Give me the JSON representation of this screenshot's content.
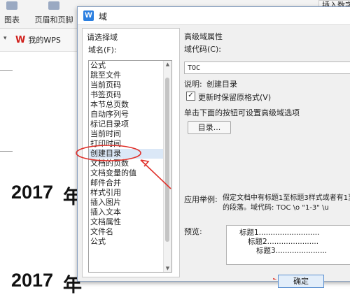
{
  "ribbon": {
    "chart_label": "图表",
    "header_footer_label": "页眉和页脚",
    "insert_number_label": "插入数字"
  },
  "tabs": {
    "wps_label": "我的WPS"
  },
  "document": {
    "line1_year": "2017",
    "line1_rest": "年",
    "line2_year": "2017",
    "line2_rest": "年"
  },
  "dialog": {
    "title": "域",
    "left": {
      "section_title": "请选择域",
      "field_name_label": "域名(F):",
      "items": [
        "公式",
        "跳至文件",
        "当前页码",
        "书签页码",
        "本节总页数",
        "自动序列号",
        "标记目录项",
        "当前时间",
        "打印时间",
        "创建目录",
        "文档的页数",
        "文档变量的值",
        "邮件合并",
        "样式引用",
        "插入图片",
        "插入文本",
        "文档属性",
        "文件名",
        "公式"
      ],
      "selected": "创建目录"
    },
    "right": {
      "section_title": "高级域属性",
      "field_code_label": "域代码(C):",
      "field_code_value": "TOC",
      "description_label": "说明:",
      "description_value": "创建目录",
      "checkbox_label": "更新时保留原格式(V)",
      "checkbox_checked": true,
      "hint": "单击下面的按钮可设置高级域选项",
      "toc_button": "目录...",
      "example_label": "应用举例:",
      "example_text": "假定文档中有标题1至标题3样式或者有1至3的段落。域代码: TOC \\o \"1-3\" \\u",
      "preview_label": "预览:",
      "preview_lines": [
        "标题1..........................",
        "标题2......................",
        "标题3......................"
      ]
    },
    "ok_button": "确定"
  },
  "colors": {
    "dialog_bg": "#f0f0f0",
    "selection_bg": "#dbe8f7",
    "annotation_red": "#e0302a",
    "wps_red": "#d0201c"
  }
}
